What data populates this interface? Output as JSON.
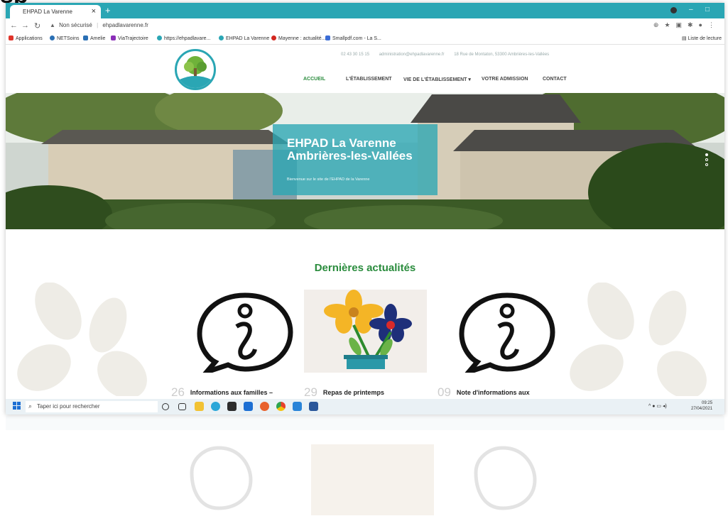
{
  "overlay_text": "sp",
  "browser": {
    "tab_title": "EHPAD La Varenne",
    "tab_close": "×",
    "new_tab": "+",
    "window_min": "–",
    "window_restore": "□",
    "security_label": "Non sécurisé",
    "url": "ehpadlavarenne.fr",
    "bookmarks": [
      {
        "label": "Applications",
        "color": "#e0342b"
      },
      {
        "label": "NETSoins",
        "color": "#2a6fb4"
      },
      {
        "label": "Amelie",
        "color": "#2a6fb4"
      },
      {
        "label": "ViaTrajectoire",
        "color": "#8b2fb8"
      },
      {
        "label": "https://ehpadlavare...",
        "color": "#2aa6b4"
      },
      {
        "label": "EHPAD La Varenne",
        "color": "#2aa6b4"
      },
      {
        "label": "Mayenne : actualité...",
        "color": "#d3271f"
      },
      {
        "label": "Smallpdf.com - La S...",
        "color": "#3b6dd6"
      }
    ],
    "reading_list": "Liste de lecture"
  },
  "site": {
    "phone": "02 43 30 15 15",
    "email": "administration@ehpadlavarenne.fr",
    "address": "18 Rue de Montaton, 53300 Ambrières-les-Vallées",
    "nav": [
      {
        "label": "ACCUEIL",
        "active": true
      },
      {
        "label": "L'ÉTABLISSEMENT",
        "active": false
      },
      {
        "label": "VIE DE L'ÉTABLISSEMENT ▾",
        "active": false
      },
      {
        "label": "VOTRE ADMISSION",
        "active": false
      },
      {
        "label": "CONTACT",
        "active": false
      }
    ],
    "hero": {
      "title_line1": "EHPAD La Varenne",
      "title_line2": "Ambrières-les-Vallées",
      "subtitle": "Bienvenue sur le site de l'EHPAD de la Varenne",
      "slides": 3,
      "active_slide": 1
    },
    "section_title": "Dernières actualités",
    "news": [
      {
        "day": "26",
        "title": "Informations aux familles –"
      },
      {
        "day": "29",
        "title": "Repas de printemps"
      },
      {
        "day": "09",
        "title": "Note d'informations aux"
      }
    ]
  },
  "taskbar": {
    "search_placeholder": "Taper ici pour rechercher",
    "time": "09:25",
    "date": "27/04/2021",
    "apps": [
      {
        "icon": "cortana-icon",
        "color": "#ffffff"
      },
      {
        "icon": "task-view-icon",
        "color": "#ffffff"
      },
      {
        "icon": "file-explorer-icon",
        "color": "#f2c233"
      },
      {
        "icon": "edge-icon",
        "color": "#2aa6d8"
      },
      {
        "icon": "store-icon",
        "color": "#2d2d2d"
      },
      {
        "icon": "mail-icon",
        "color": "#1d6fd3"
      },
      {
        "icon": "firefox-icon",
        "color": "#e8612c"
      },
      {
        "icon": "chrome-icon",
        "color": "#e8412c"
      },
      {
        "icon": "teamviewer-icon",
        "color": "#2a84d8"
      },
      {
        "icon": "word-icon",
        "color": "#2b579a"
      }
    ]
  },
  "colors": {
    "accent": "#2aa6b4",
    "green": "#2a8c3d"
  }
}
